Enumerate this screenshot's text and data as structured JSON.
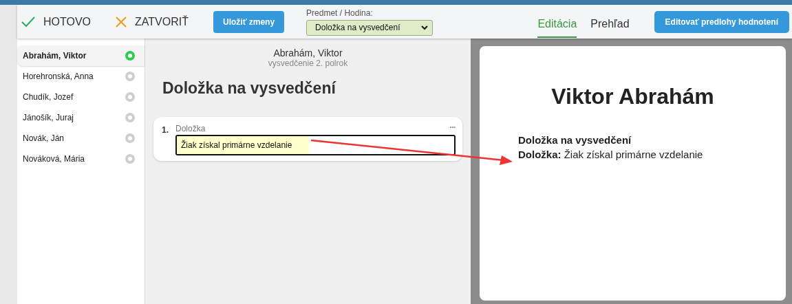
{
  "toolbar": {
    "done": "HOTOVO",
    "close": "ZATVORIŤ",
    "save": "Uložiť zmeny",
    "subject": {
      "label": "Predmet / Hodina:",
      "value": "Doložka na vysvedčení"
    },
    "tabs": [
      {
        "label": "Editácia",
        "selected": true
      },
      {
        "label": "Prehľad",
        "selected": false
      }
    ],
    "edit_templates": "Editovať predlohy hodnotení"
  },
  "students": [
    {
      "name": "Abrahám, Viktor",
      "selected": true,
      "done": true
    },
    {
      "name": "Horehronská, Anna",
      "selected": false,
      "done": false
    },
    {
      "name": "Chudík, Jozef",
      "selected": false,
      "done": false
    },
    {
      "name": "Jánošík, Juraj",
      "selected": false,
      "done": false
    },
    {
      "name": "Novák, Ján",
      "selected": false,
      "done": false
    },
    {
      "name": "Nováková, Mária",
      "selected": false,
      "done": false
    }
  ],
  "editor": {
    "student": "Abrahám, Viktor",
    "report": "vysvedčenie 2. polrok",
    "title": "Doložka na vysvedčení",
    "items": [
      {
        "number": "1.",
        "label": "Doložka",
        "more": "•••",
        "value": "Žiak získal primárne vzdelanie"
      }
    ]
  },
  "preview": {
    "name": "Viktor Abrahám",
    "section": "Doložka na vysvedčení",
    "lines": [
      {
        "label": "Doložka:",
        "value": "Žiak získal primárne vzdelanie"
      }
    ]
  }
}
